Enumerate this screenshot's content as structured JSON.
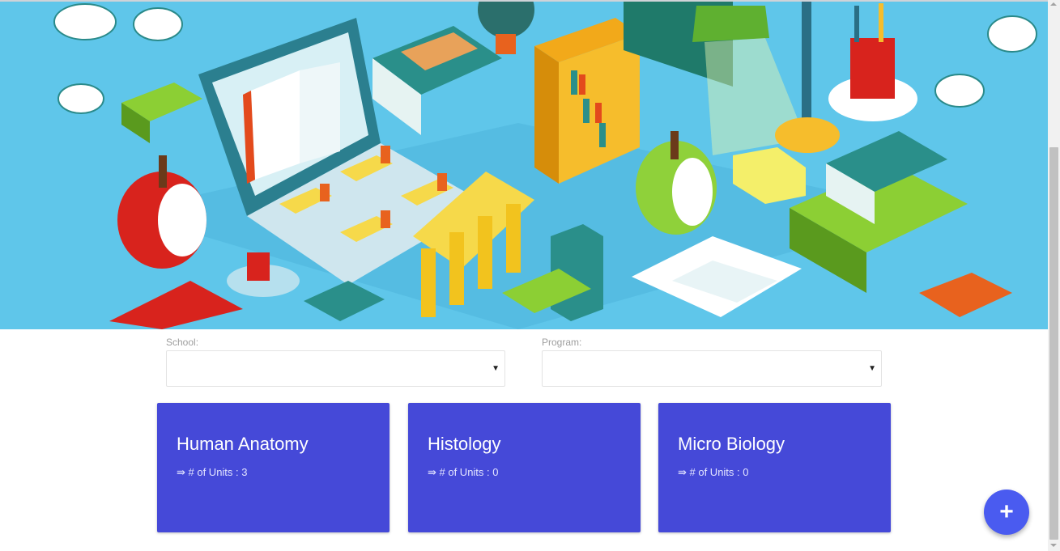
{
  "hero": {
    "icon": "education-isometric-illustration"
  },
  "filters": {
    "school": {
      "label": "School:",
      "value": ""
    },
    "program": {
      "label": "Program:",
      "value": ""
    }
  },
  "courses": [
    {
      "title": "Human Anatomy",
      "units_label": "⇛ # of Units : 3"
    },
    {
      "title": "Histology",
      "units_label": "⇛ # of Units : 0"
    },
    {
      "title": "Micro Biology",
      "units_label": "⇛ # of Units : 0"
    }
  ],
  "fab": {
    "icon": "plus-icon",
    "symbol": "+"
  },
  "colors": {
    "card": "#4549d8",
    "fab": "#4a5bf0",
    "hero_bg": "#5fc6ea"
  }
}
